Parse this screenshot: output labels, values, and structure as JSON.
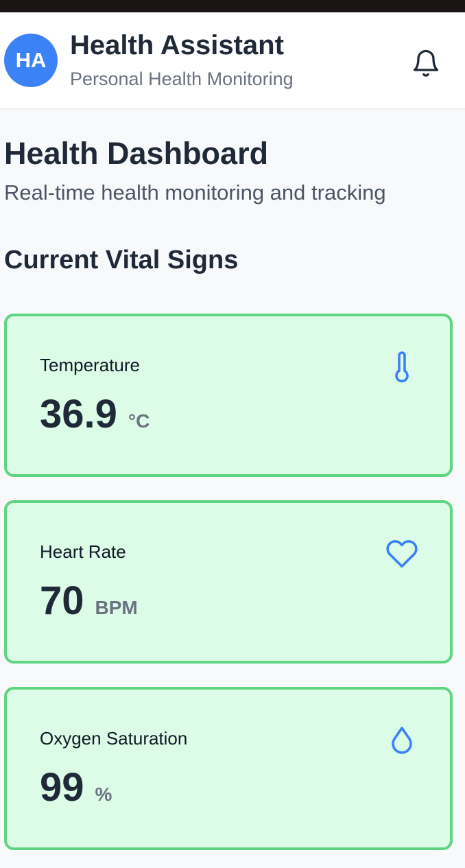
{
  "header": {
    "avatar_initials": "HA",
    "title": "Health Assistant",
    "subtitle": "Personal Health Monitoring",
    "notification_icon": "bell-icon"
  },
  "page": {
    "title": "Health Dashboard",
    "subtitle": "Real-time health monitoring and tracking",
    "section_title": "Current Vital Signs"
  },
  "vitals": [
    {
      "label": "Temperature",
      "value": "36.9",
      "unit": "°C",
      "icon": "thermometer-icon"
    },
    {
      "label": "Heart Rate",
      "value": "70",
      "unit": "BPM",
      "icon": "heart-icon"
    },
    {
      "label": "Oxygen Saturation",
      "value": "99",
      "unit": "%",
      "icon": "droplet-icon"
    }
  ],
  "colors": {
    "accent": "#3b82f6",
    "card_background": "#dcfce7",
    "card_border": "#5fd481"
  }
}
